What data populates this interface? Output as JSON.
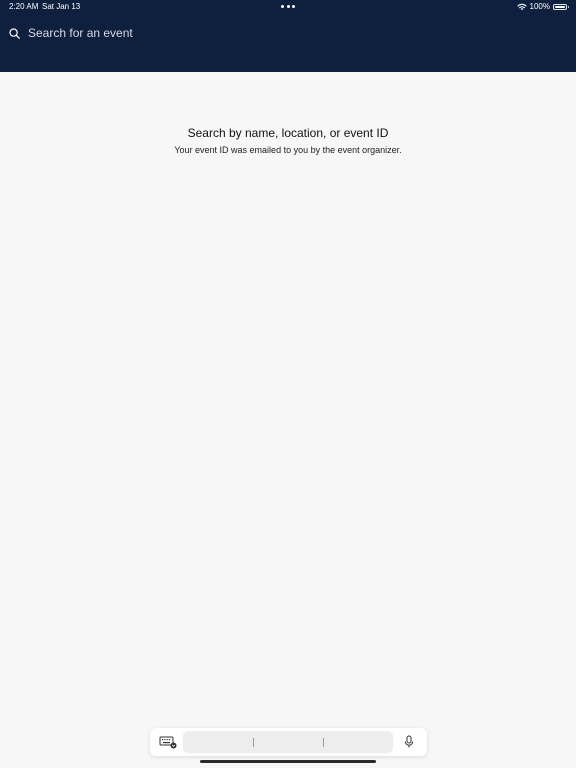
{
  "status_bar": {
    "time": "2:20 AM",
    "date": "Sat Jan 13",
    "battery": "100%",
    "icons": [
      "wifi-icon",
      "battery-icon",
      "more-dots-icon"
    ]
  },
  "search": {
    "placeholder": "Search for an event",
    "value": "",
    "icon": "search-icon"
  },
  "empty_state": {
    "title": "Search by name, location, or event ID",
    "subtitle": "Your event ID was emailed to you by the event organizer."
  },
  "keyboard_bar": {
    "icons": [
      "keyboard-icon",
      "microphone-icon"
    ]
  },
  "colors": {
    "header_bg": "#0f1f3e",
    "page_bg": "#f7f7f7"
  }
}
